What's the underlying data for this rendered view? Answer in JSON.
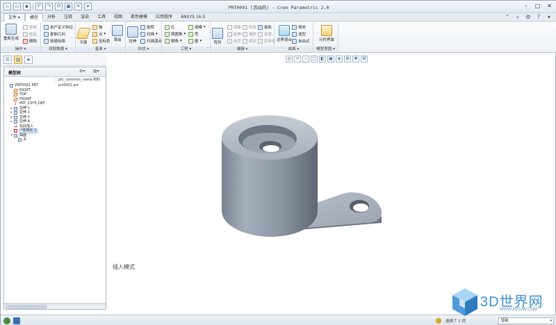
{
  "window": {
    "title": "PRT0001 (活动的) - Creo Parametric 2.0"
  },
  "quick_access": [
    "new",
    "open",
    "save",
    "undo",
    "redo",
    "regenerate",
    "windows",
    "close"
  ],
  "tabs": [
    "文件",
    "模型",
    "分析",
    "注释",
    "渲染",
    "工具",
    "视图",
    "柔性建模",
    "应用程序",
    "ANSYS 16.0"
  ],
  "active_tab": "模型",
  "ribbon": {
    "groups": {
      "operations": {
        "label": "操作",
        "regen": "重新生成",
        "copy": "复制",
        "paste": "粘贴",
        "delete": "删除"
      },
      "get_data": {
        "label": "获取数据",
        "udf": "用户定义特征",
        "copy_geom": "复制几何",
        "shrinkwrap": "收缩包络"
      },
      "datum": {
        "label": "基准",
        "plane": "平面",
        "axis": "轴",
        "point": "点",
        "csys": "坐标系",
        "sketch": "草绘"
      },
      "shapes": {
        "label": "形状",
        "extrude": "拉伸",
        "revolve": "旋转",
        "sweep": "扫描",
        "blend": "扫描混合"
      },
      "engineering": {
        "label": "工程",
        "hole": "孔",
        "round": "倒圆角",
        "chamfer": "倒角",
        "draft": "拔模",
        "shell": "壳",
        "rib": "筋"
      },
      "editing": {
        "label": "编辑",
        "pattern": "阵列",
        "mirror": "镜像",
        "merge": "合并",
        "trim": "修剪",
        "intersect": "相交",
        "offset": "偏移",
        "thicken": "加厚",
        "solidify": "实体化",
        "project": "投影",
        "extend": "延伸",
        "wrap": "包络"
      },
      "surfaces": {
        "label": "曲面",
        "freestyle": "边界混合",
        "fill": "填充",
        "style": "造型",
        "freestyle2": "自由式"
      },
      "model_intent": {
        "label": "模型意图",
        "family_table": "元件界面"
      }
    }
  },
  "model_tree": {
    "title": "模型树",
    "columns": [
      "",
      "ptc_common_name",
      "材料"
    ],
    "items": [
      {
        "label": "PRT0001.PRT",
        "value": "prt0001.prt",
        "icon": "part-icon",
        "expand": ""
      },
      {
        "label": "RIGHT",
        "value": "",
        "icon": "plane-icon",
        "expand": ""
      },
      {
        "label": "TOP",
        "value": "",
        "icon": "plane-icon",
        "expand": ""
      },
      {
        "label": "FRONT",
        "value": "",
        "icon": "plane-icon",
        "expand": ""
      },
      {
        "label": "PRT_CSYS_DEF",
        "value": "",
        "icon": "csys-icon",
        "expand": ""
      },
      {
        "label": "拉伸 1",
        "value": "",
        "icon": "extrude-icon",
        "expand": "▸"
      },
      {
        "label": "拉伸 2",
        "value": "",
        "icon": "extrude-icon",
        "expand": "▸"
      },
      {
        "label": "拉伸 3",
        "value": "",
        "icon": "extrude-icon",
        "expand": "▸"
      },
      {
        "label": "拉伸 4",
        "value": "",
        "icon": "extrude-icon",
        "expand": "▸"
      },
      {
        "label": "在此插入",
        "value": "",
        "icon": "insert-icon",
        "expand": ""
      },
      {
        "label": "*实体化 1",
        "value": "",
        "icon": "star-icon",
        "expand": "",
        "highlight": true
      },
      {
        "label": "曲面",
        "value": "",
        "icon": "surface-icon",
        "expand": "▾"
      },
      {
        "label": "A",
        "value": "",
        "icon": "surface-icon",
        "expand": ""
      }
    ]
  },
  "graphics_toolbar": [
    "refit",
    "zoom-in",
    "zoom-out",
    "repaint",
    "shading",
    "saved-views",
    "display-style",
    "datum-display",
    "spin-center",
    "annotation"
  ],
  "viewport": {
    "mode_text": "插入模式"
  },
  "status": {
    "selected_text": "选择了 1 项",
    "filter_value": "智能"
  },
  "watermark": {
    "text": "3D世界网",
    "url": "WWW.3DSJW.COM"
  }
}
